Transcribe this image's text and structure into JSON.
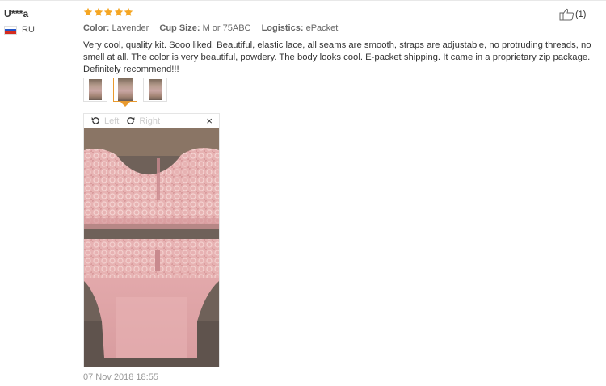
{
  "review": {
    "user": "U***a",
    "country": "RU",
    "rating": 5,
    "attributes": [
      {
        "label": "Color:",
        "value": "Lavender"
      },
      {
        "label": "Cup Size:",
        "value": "M or 75ABC"
      },
      {
        "label": "Logistics:",
        "value": "ePacket"
      }
    ],
    "text": "Very cool, quality kit. Sooo liked. Beautiful, elastic lace, all seams are smooth, straps are adjustable, no protruding threads, no smell at all. The color is very beautiful, powdery. The body looks cool. E-packet shipping. It came in a proprietary zip package. Definitely recommend!!!",
    "date": "07 Nov 2018 18:55",
    "useful_count": "(1)"
  },
  "viewer": {
    "rotate_left": "Left",
    "rotate_right": "Right",
    "close": "×"
  },
  "colors": {
    "star": "#f5a623",
    "accent": "#e99a2e"
  }
}
